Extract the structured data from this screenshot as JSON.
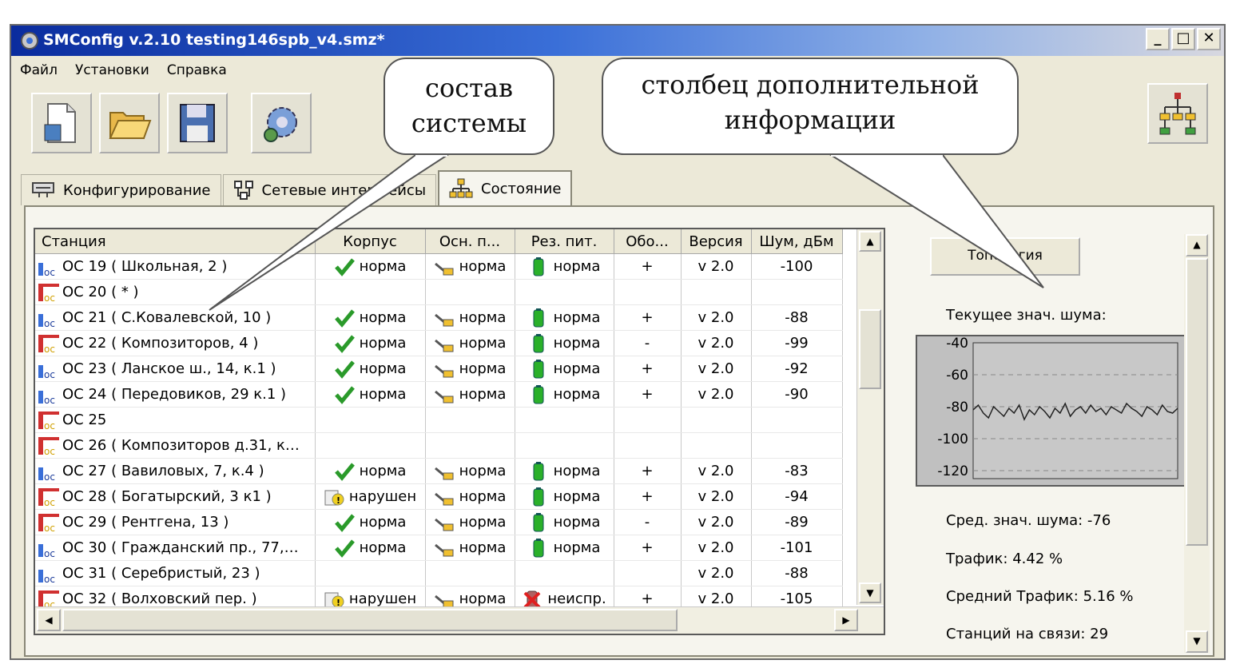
{
  "window": {
    "title": "SMConfig v.2.10 testing146spb_v4.smz*",
    "buttons": {
      "minimize": "_",
      "maximize": "□",
      "close": "✕"
    }
  },
  "menu": [
    "Файл",
    "Установки",
    "Справка"
  ],
  "toolbar": {
    "icons": [
      "new-config-icon",
      "open-folder-icon",
      "save-icon",
      "settings-gear-icon"
    ],
    "right_icon": "topology-tree-icon"
  },
  "tabs": [
    {
      "label": "Конфигурирование",
      "icon": "config-icon"
    },
    {
      "label": "Сетевые интерфейсы",
      "icon": "network-interfaces-icon"
    },
    {
      "label": "Состояние",
      "icon": "status-tree-icon",
      "active": true
    }
  ],
  "table": {
    "columns": [
      "Станция",
      "Корпус",
      "Осн. п...",
      "Рез. пит.",
      "Обо...",
      "Версия",
      "Шум, дБм"
    ],
    "rows": [
      {
        "station": "ОС 19 ( Школьная, 2 )",
        "type": "oc",
        "case": "норма",
        "case_status": "ok",
        "main": "норма",
        "reserve": "норма",
        "reserve_status": "ok",
        "equip": "+",
        "version": "v 2.0",
        "noise": "-100"
      },
      {
        "station": "ОС 20 ( * )",
        "type": "alarm",
        "case": "",
        "case_status": "",
        "main": "",
        "reserve": "",
        "reserve_status": "",
        "equip": "",
        "version": "",
        "noise": ""
      },
      {
        "station": "ОС 21 ( С.Ковалевской, 10 )",
        "type": "oc",
        "case": "норма",
        "case_status": "ok",
        "main": "норма",
        "reserve": "норма",
        "reserve_status": "ok",
        "equip": "+",
        "version": "v 2.0",
        "noise": "-88"
      },
      {
        "station": "ОС 22 ( Композиторов, 4 )",
        "type": "alarm",
        "case": "норма",
        "case_status": "ok",
        "main": "норма",
        "reserve": "норма",
        "reserve_status": "ok",
        "equip": "-",
        "version": "v 2.0",
        "noise": "-99"
      },
      {
        "station": "ОС 23 ( Ланское ш., 14, к.1 )",
        "type": "oc",
        "case": "норма",
        "case_status": "ok",
        "main": "норма",
        "reserve": "норма",
        "reserve_status": "ok",
        "equip": "+",
        "version": "v 2.0",
        "noise": "-92"
      },
      {
        "station": "ОС 24 ( Передовиков, 29 к.1 )",
        "type": "oc",
        "case": "норма",
        "case_status": "ok",
        "main": "норма",
        "reserve": "норма",
        "reserve_status": "ok",
        "equip": "+",
        "version": "v 2.0",
        "noise": "-90"
      },
      {
        "station": "ОС 25",
        "type": "alarm",
        "case": "",
        "case_status": "",
        "main": "",
        "reserve": "",
        "reserve_status": "",
        "equip": "",
        "version": "",
        "noise": ""
      },
      {
        "station": "ОС 26 ( Композиторов д.31, к…",
        "type": "alarm",
        "case": "",
        "case_status": "",
        "main": "",
        "reserve": "",
        "reserve_status": "",
        "equip": "",
        "version": "",
        "noise": ""
      },
      {
        "station": "ОС 27 ( Вавиловых, 7, к.4 )",
        "type": "oc",
        "case": "норма",
        "case_status": "ok",
        "main": "норма",
        "reserve": "норма",
        "reserve_status": "ok",
        "equip": "+",
        "version": "v 2.0",
        "noise": "-83"
      },
      {
        "station": "ОС 28 ( Богатырский, 3 к1 )",
        "type": "alarm",
        "case": "нарушен",
        "case_status": "warn",
        "main": "норма",
        "reserve": "норма",
        "reserve_status": "ok",
        "equip": "+",
        "version": "v 2.0",
        "noise": "-94"
      },
      {
        "station": "ОС 29 ( Рентгена, 13 )",
        "type": "alarm",
        "case": "норма",
        "case_status": "ok",
        "main": "норма",
        "reserve": "норма",
        "reserve_status": "ok",
        "equip": "-",
        "version": "v 2.0",
        "noise": "-89"
      },
      {
        "station": "ОС 30 ( Гражданский пр., 77,…",
        "type": "oc",
        "case": "норма",
        "case_status": "ok",
        "main": "норма",
        "reserve": "норма",
        "reserve_status": "ok",
        "equip": "+",
        "version": "v 2.0",
        "noise": "-101"
      },
      {
        "station": "ОС 31 ( Серебристый, 23 )",
        "type": "oc",
        "case": "",
        "case_status": "",
        "main": "",
        "reserve": "",
        "reserve_status": "",
        "equip": "",
        "version": "v 2.0",
        "noise": "-88"
      },
      {
        "station": "ОС 32 ( Волховский пер. )",
        "type": "alarm",
        "case": "нарушен",
        "case_status": "warn",
        "main": "норма",
        "reserve": "неиспр.",
        "reserve_status": "fail",
        "equip": "+",
        "version": "v 2.0",
        "noise": "-105"
      }
    ]
  },
  "side_panel": {
    "topology_button": "Топология",
    "current_noise_label": "Текущее знач. шума:",
    "avg_noise": "Сред. знач. шума: -76",
    "traffic": "Трафик: 4.42 %",
    "avg_traffic": "Средний Трафик: 5.16 %",
    "stations_online": "Станций на связи: 29"
  },
  "chart_data": {
    "type": "line",
    "ylim": [
      -125,
      -40
    ],
    "yticks": [
      "-40",
      "-60",
      "-80",
      "-100",
      "-120"
    ],
    "grid": "dashed horizontal",
    "series": [
      {
        "values": [
          -82,
          -79,
          -84,
          -87,
          -80,
          -83,
          -86,
          -81,
          -84,
          -79,
          -88,
          -82,
          -85,
          -80,
          -83,
          -87,
          -81,
          -84,
          -78,
          -86,
          -82,
          -80,
          -84,
          -79,
          -83,
          -81,
          -85,
          -80,
          -82,
          -84,
          -78,
          -81,
          -83,
          -86,
          -80,
          -82,
          -85,
          -79,
          -83,
          -84,
          -81
        ]
      }
    ],
    "colors": {
      "line": "#222222",
      "background": "#c0c0c0"
    }
  },
  "annotations": {
    "callout_system": [
      "состав",
      "системы"
    ],
    "callout_info": [
      "столбец дополнительной",
      "информации"
    ]
  },
  "colors": {
    "title_start": "#0a2c9e",
    "title_end": "#d8d8e0",
    "chrome": "#ece9d8"
  }
}
